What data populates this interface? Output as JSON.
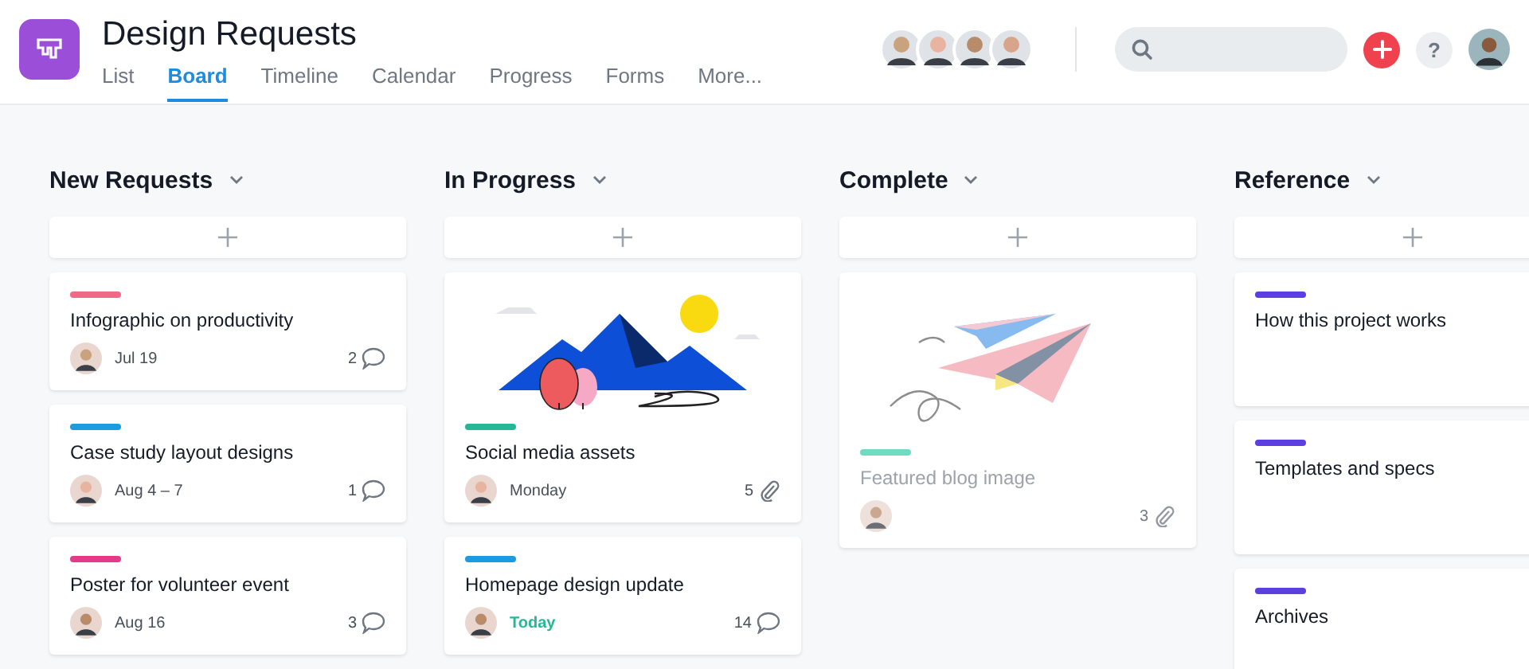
{
  "project": {
    "title": "Design Requests"
  },
  "tabs": [
    {
      "label": "List",
      "selected": false
    },
    {
      "label": "Board",
      "selected": true
    },
    {
      "label": "Timeline",
      "selected": false
    },
    {
      "label": "Calendar",
      "selected": false
    },
    {
      "label": "Progress",
      "selected": false
    },
    {
      "label": "Forms",
      "selected": false
    },
    {
      "label": "More...",
      "selected": false
    }
  ],
  "help_button": {
    "label": "?"
  },
  "columns": [
    {
      "title": "New Requests",
      "cards": [
        {
          "kind": "task",
          "color": "#f06a85",
          "title": "Infographic on productivity",
          "due": "Jul 19",
          "due_today": false,
          "completed": false,
          "count": {
            "kind": "comments",
            "value": "2"
          }
        },
        {
          "kind": "task",
          "color": "#1d9be0",
          "title": "Case study layout designs",
          "due": "Aug 4 – 7",
          "due_today": false,
          "completed": false,
          "count": {
            "kind": "comments",
            "value": "1"
          }
        },
        {
          "kind": "task",
          "color": "#e8388a",
          "title": "Poster for volunteer event",
          "due": "Aug 16",
          "due_today": false,
          "completed": false,
          "count": {
            "kind": "comments",
            "value": "3"
          }
        }
      ]
    },
    {
      "title": "In Progress",
      "cards": [
        {
          "kind": "mountains",
          "color": "#25b897",
          "title": "Social media assets",
          "due": "Monday",
          "due_today": false,
          "completed": false,
          "count": {
            "kind": "attachments",
            "value": "5"
          }
        },
        {
          "kind": "task",
          "color": "#1d9be0",
          "title": "Homepage design update",
          "due": "Today",
          "due_today": true,
          "completed": false,
          "count": {
            "kind": "comments",
            "value": "14"
          }
        }
      ]
    },
    {
      "title": "Complete",
      "cards": [
        {
          "kind": "planes",
          "color": "#6fdcc2",
          "title": "Featured blog image",
          "completed": true,
          "count": {
            "kind": "attachments",
            "value": "3"
          }
        }
      ]
    },
    {
      "title": "Reference",
      "cards": [
        {
          "kind": "note",
          "color": "#5b3fe0",
          "title": "How this project works"
        },
        {
          "kind": "note",
          "color": "#5b3fe0",
          "title": "Templates and specs"
        },
        {
          "kind": "note",
          "color": "#5b3fe0",
          "title": "Archives"
        }
      ]
    }
  ]
}
